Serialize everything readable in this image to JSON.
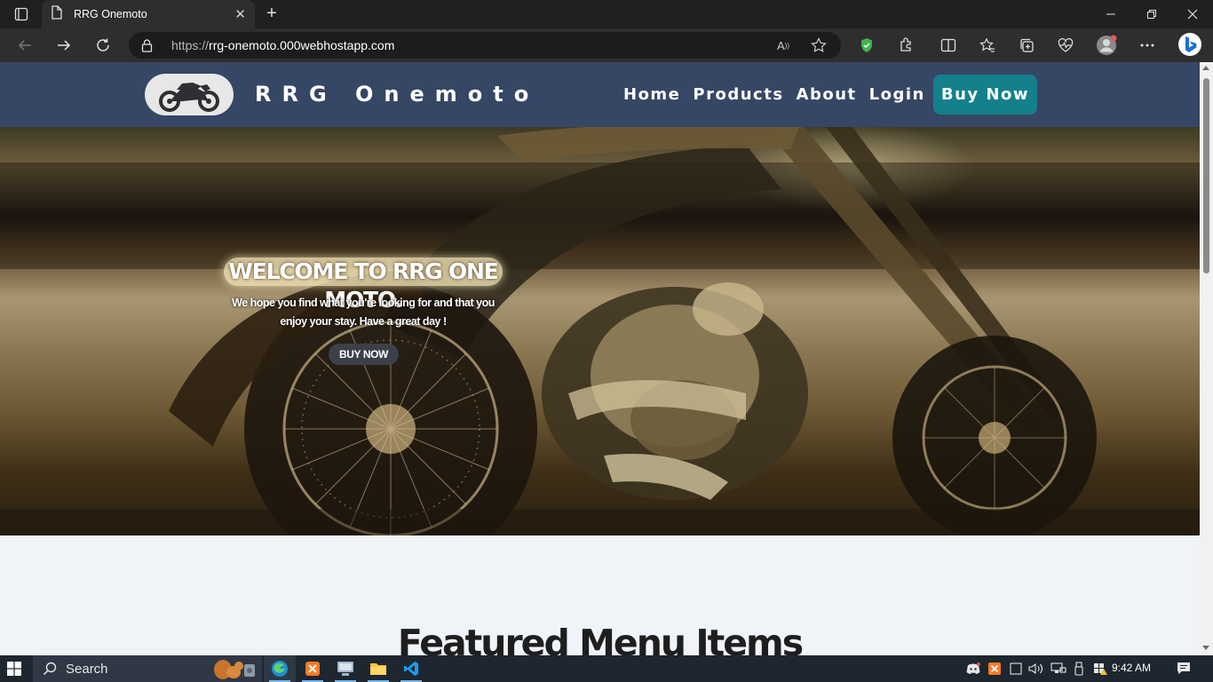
{
  "browser": {
    "tab_title": "RRG Onemoto",
    "url_prefix": "https://",
    "url_host": "rrg-onemoto.000webhostapp.com"
  },
  "site": {
    "brand": "RRG Onemoto",
    "nav": {
      "home": "Home",
      "products": "Products",
      "about": "About",
      "login": "Login",
      "buy_now": "Buy Now"
    },
    "hero": {
      "title": "WELCOME TO RRG ONE MOTO.",
      "subtitle": "We hope you find what you're looking for and that you enjoy your stay. Have a great day !",
      "button": "BUY NOW"
    },
    "section_title": "Featured Menu Items"
  },
  "taskbar": {
    "search_label": "Search",
    "time": "9:42 AM"
  },
  "colors": {
    "header_bg": "#364665",
    "buy_button": "#13808c",
    "page_bg": "#f0f4f8"
  }
}
